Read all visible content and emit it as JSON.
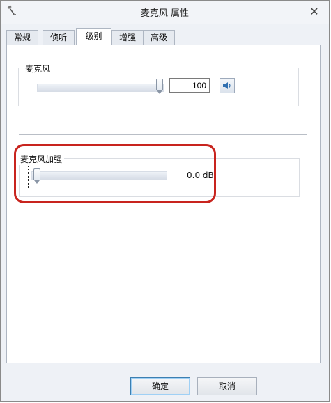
{
  "window": {
    "title": "麦克风 属性"
  },
  "tabs": [
    {
      "label": "常规"
    },
    {
      "label": "侦听"
    },
    {
      "label": "级别"
    },
    {
      "label": "增强"
    },
    {
      "label": "高级"
    }
  ],
  "microphone": {
    "label": "麦克风",
    "level_value": "100",
    "level_fraction": 1.0
  },
  "boost": {
    "label": "麦克风加强",
    "value_text": "0.0 dB",
    "level_fraction": 0.0
  },
  "buttons": {
    "ok": "确定",
    "cancel": "取消"
  }
}
